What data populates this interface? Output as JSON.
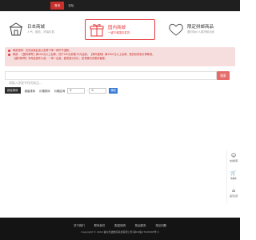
{
  "topnav": {
    "items": [
      {
        "label": "首页"
      },
      {
        "label": "论坛"
      }
    ]
  },
  "cards": [
    {
      "title": "日本商城",
      "sub": "人气、服务、终端可靠"
    },
    {
      "title": "国内商城",
      "sub": "一键下单国内发货"
    },
    {
      "title": "限定拼邮商品",
      "sub": "限时特价人群拼邮派家"
    }
  ],
  "notice": {
    "line1": "邮费说明：请先阅读此处公告再下单一律不予退款。",
    "line2": "邮费：【国内邮寄】满200元以上包邮，低于200元收取10元运费；【海外直邮】满1000元以上包邮，按实际重量计算邮费。",
    "line3": "【国内邮寄】本商品按件计费，一单一运费，超重部分另计，如有疑问请联系客服。"
  },
  "search": {
    "placeholder": "请输入你要寻找的商品...",
    "button": "搜索"
  },
  "filters": {
    "active": "综合排序",
    "sales": "销量排序",
    "price": "价格排序",
    "range_label": "价格区间",
    "min": "0",
    "dash": "-",
    "max": "0",
    "ok": "确定"
  },
  "side": [
    {
      "icon": "☺",
      "label": "在线客服"
    },
    {
      "icon": "🛒",
      "label": "购物车"
    },
    {
      "icon": "⌂",
      "label": "返回顶部"
    }
  ],
  "footer": {
    "links": [
      "关于我们",
      "联系我们",
      "配送说明",
      "售后服务",
      "常见问题"
    ],
    "copyright": "Copyright © 2019 福州日猫数码科技有限公司 闽ICP备17026305号-3"
  },
  "colors": {
    "accent": "#e4393c",
    "topbar": "#1f1f1f",
    "footer": "#141414",
    "notice_bg": "#f7dede"
  }
}
